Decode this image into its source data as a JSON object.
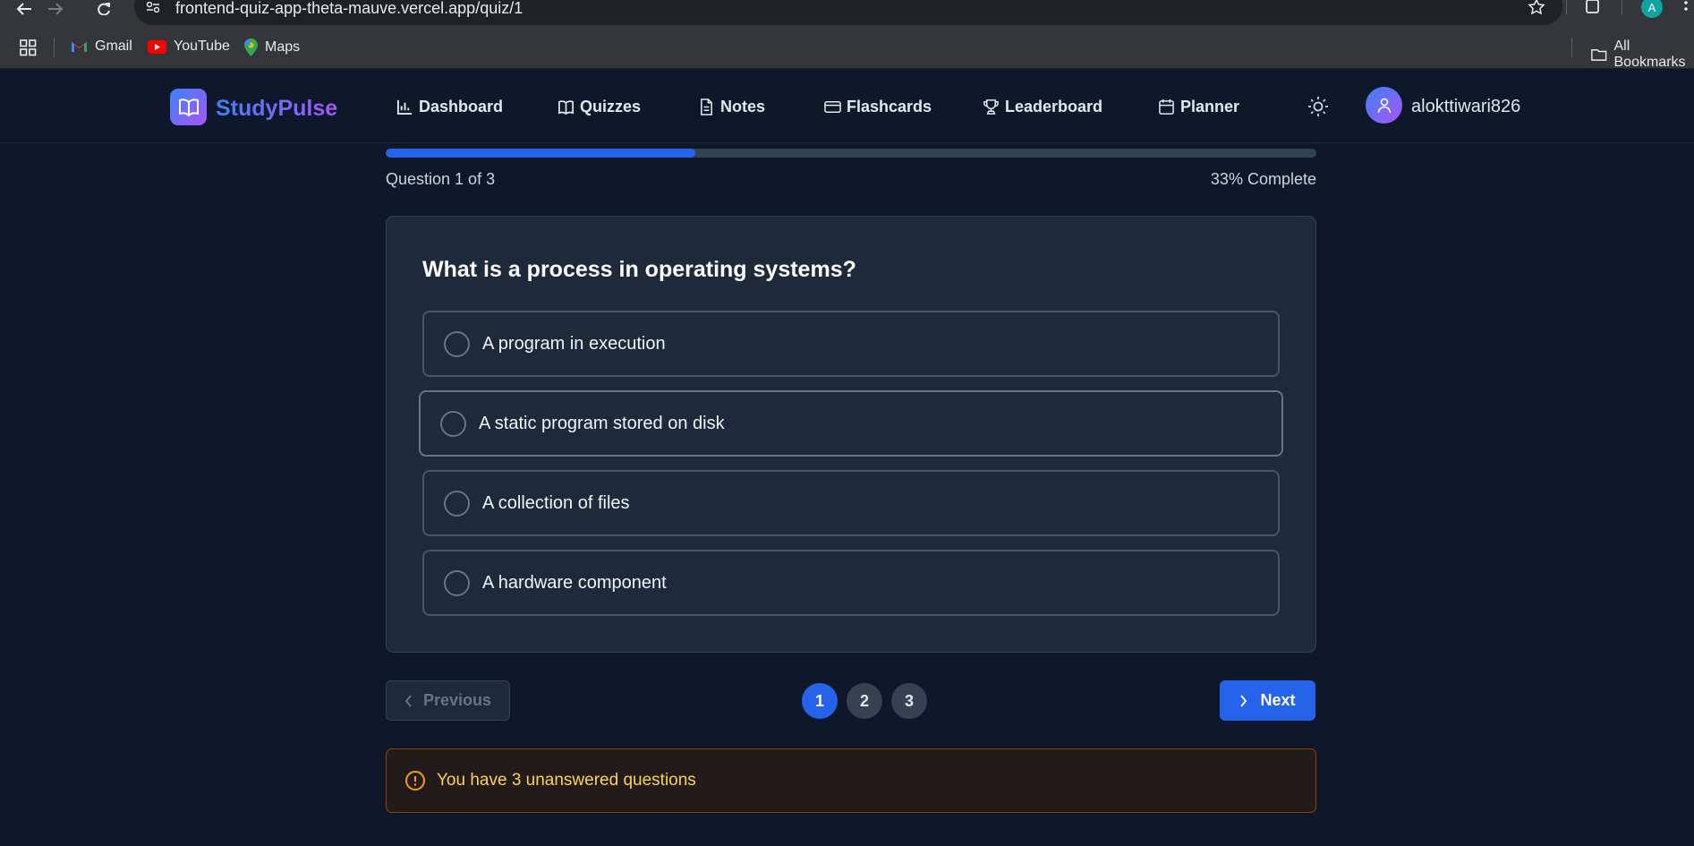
{
  "browser": {
    "url": "frontend-quiz-app-theta-mauve.vercel.app/quiz/1",
    "profile_initial": "A",
    "bookmarks": [
      {
        "label": "Gmail",
        "icon": "gmail-icon"
      },
      {
        "label": "YouTube",
        "icon": "youtube-icon"
      },
      {
        "label": "Maps",
        "icon": "maps-icon"
      }
    ],
    "all_bookmarks": "All Bookmarks"
  },
  "header": {
    "brand": "StudyPulse",
    "nav": [
      {
        "label": "Dashboard",
        "icon": "bar-chart-icon"
      },
      {
        "label": "Quizzes",
        "icon": "book-open-icon"
      },
      {
        "label": "Notes",
        "icon": "file-text-icon"
      },
      {
        "label": "Flashcards",
        "icon": "credit-card-icon"
      },
      {
        "label": "Leaderboard",
        "icon": "trophy-icon"
      },
      {
        "label": "Planner",
        "icon": "calendar-icon"
      }
    ],
    "theme_icon": "sun-icon",
    "username": "alokttiwari826"
  },
  "progress": {
    "fraction": 0.333,
    "question_label": "Question 1 of 3",
    "complete_label": "33% Complete"
  },
  "quiz": {
    "question": "What is a process in operating systems?",
    "options": [
      "A program in execution",
      "A static program stored on disk",
      "A collection of files",
      "A hardware component"
    ]
  },
  "pager": {
    "previous_label": "Previous",
    "next_label": "Next",
    "pages": [
      "1",
      "2",
      "3"
    ],
    "current_page": "1"
  },
  "alert": {
    "text": "You have 3 unanswered questions",
    "icon": "alert-circle-icon"
  },
  "colors": {
    "background": "#0f172a",
    "card": "#1e293b",
    "accent": "#2563eb",
    "warning": "#fcd34d"
  }
}
